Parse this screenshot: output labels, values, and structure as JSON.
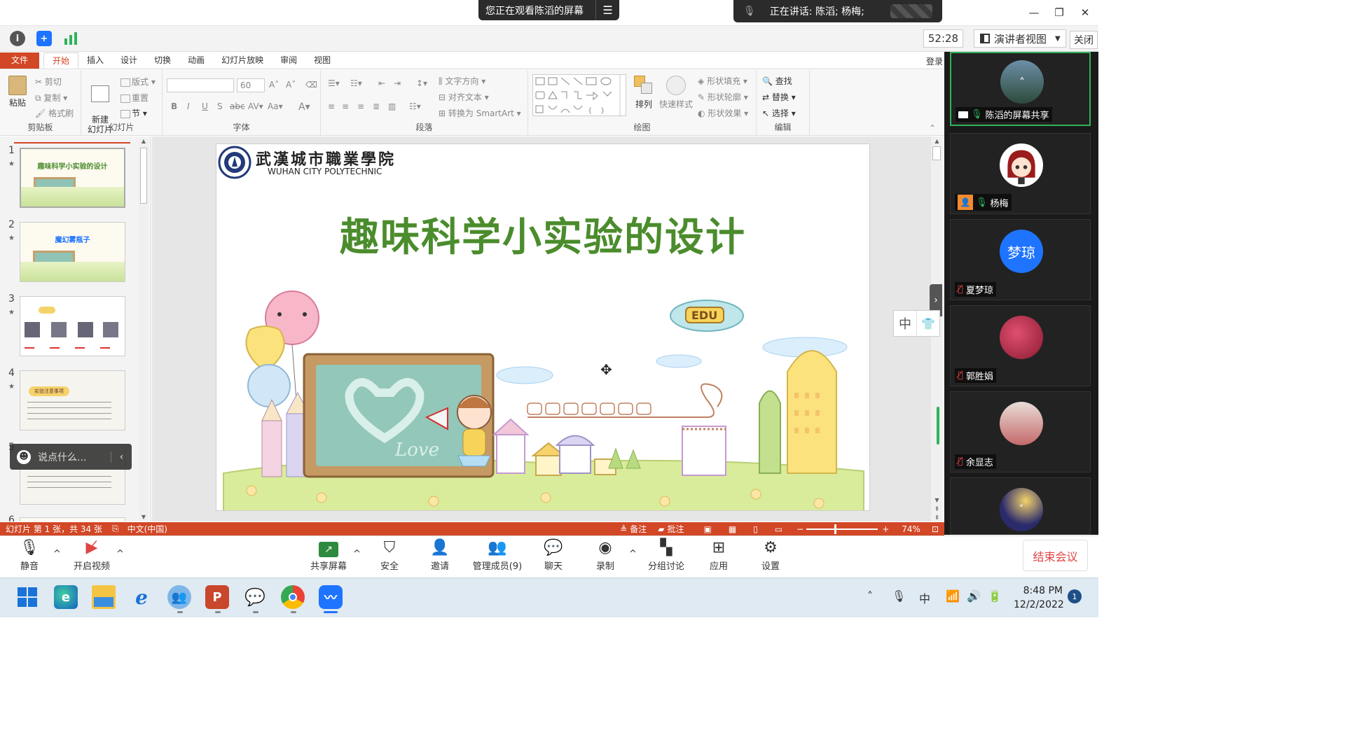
{
  "window": {
    "viewing_banner": "您正在观看陈滔的屏幕",
    "speaking_banner": "正在讲话: 陈滔; 杨梅;",
    "timer": "52:28",
    "presenter_view": "演讲者视图",
    "close_label": "关闭"
  },
  "ribbon": {
    "tabs": [
      "文件",
      "开始",
      "插入",
      "设计",
      "切换",
      "动画",
      "幻灯片放映",
      "审阅",
      "视图"
    ],
    "login": "登录",
    "clipboard": {
      "paste": "粘贴",
      "cut": "剪切",
      "copy": "复制",
      "format_painter": "格式刷",
      "label": "剪贴板"
    },
    "slides": {
      "new_slide": "新建\n幻灯片",
      "layout": "版式",
      "reset": "重置",
      "section": "节",
      "label": "幻灯片"
    },
    "font": {
      "size": "60",
      "label": "字体"
    },
    "paragraph": {
      "text_direction": "文字方向",
      "align_text": "对齐文本",
      "smartart": "转换为 SmartArt",
      "label": "段落"
    },
    "drawing": {
      "arrange": "排列",
      "quick_styles": "快速样式",
      "shape_fill": "形状填充",
      "shape_outline": "形状轮廓",
      "shape_effects": "形状效果",
      "label": "绘图"
    },
    "editing": {
      "find": "查找",
      "replace": "替换",
      "select": "选择",
      "label": "编辑"
    }
  },
  "thumbnails": [
    {
      "num": "1",
      "title": "趣味科学小实验的设计"
    },
    {
      "num": "2",
      "title": "魔幻雾瓶子"
    },
    {
      "num": "3",
      "title": ""
    },
    {
      "num": "4",
      "title": "实验注意事项"
    },
    {
      "num": "5",
      "title": ""
    },
    {
      "num": "6",
      "title": ""
    }
  ],
  "chat_placeholder": "说点什么...",
  "slide": {
    "logo_cn": "武漢城市職業學院",
    "logo_en": "WUHAN CITY POLYTECHNIC",
    "title": "趣味科学小实验的设计",
    "blimp_text": "EDU",
    "board_text": "Love"
  },
  "ime": {
    "lang": "中",
    "skin": "👕"
  },
  "status": {
    "slide_info": "幻灯片 第 1 张，共 34 张",
    "language": "中文(中国)",
    "notes": "备注",
    "comments": "批注",
    "zoom": "74%"
  },
  "participants": [
    {
      "name": "陈滔的屏幕共享",
      "mic": "on",
      "avatar_text": "",
      "avatar_color": "#3d5a6b"
    },
    {
      "name": "杨梅",
      "mic": "on",
      "avatar_text": "",
      "avatar_color": "#ffffff"
    },
    {
      "name": "夏梦琼",
      "mic": "muted",
      "avatar_text": "梦琼",
      "avatar_color": "#1e74ff"
    },
    {
      "name": "郭胜娟",
      "mic": "muted",
      "avatar_text": "",
      "avatar_color": "#c0394a"
    },
    {
      "name": "余显志",
      "mic": "muted",
      "avatar_text": "",
      "avatar_color": "#d8c9c4"
    },
    {
      "name": "",
      "mic": "",
      "avatar_text": "",
      "avatar_color": "#2b2b6b"
    }
  ],
  "toolbar": {
    "mute": "静音",
    "video": "开启视频",
    "share": "共享屏幕",
    "security": "安全",
    "invite": "邀请",
    "participants": "管理成员(9)",
    "chat": "聊天",
    "record": "录制",
    "breakout": "分组讨论",
    "apps": "应用",
    "settings": "设置",
    "end": "结束会议"
  },
  "taskbar": {
    "time": "8:48 PM",
    "date": "12/2/2022",
    "notifications": "1",
    "ime": "中"
  }
}
